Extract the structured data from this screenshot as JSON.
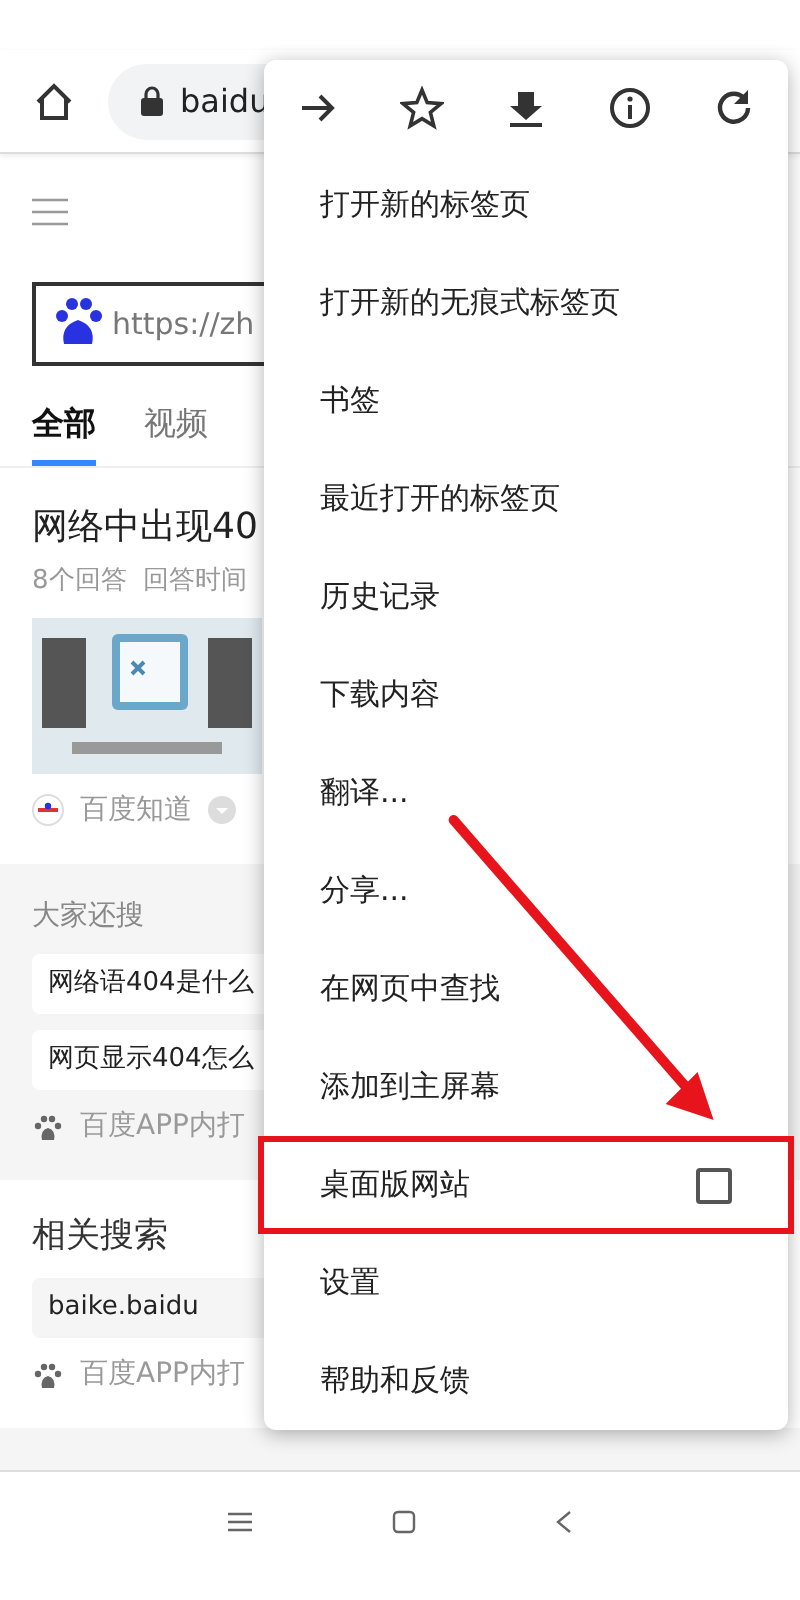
{
  "toolbar": {
    "url": "baidu"
  },
  "page": {
    "search_url": "https://zh",
    "tabs": [
      {
        "label": "全部",
        "selected": true
      },
      {
        "label": "视频",
        "selected": false
      }
    ],
    "result": {
      "title": "网络中出现40",
      "meta": [
        "8个回答",
        "回答时间"
      ],
      "source": "百度知道"
    },
    "also_searched": {
      "heading": "大家还搜",
      "chips": [
        "网络语404是什么",
        "网页显示404怎么"
      ],
      "open_in_app": "百度APP内打"
    },
    "related": {
      "heading": "相关搜索",
      "chips": [
        "baike.baidu"
      ],
      "open_in_app": "百度APP内打"
    }
  },
  "menu": {
    "actions": [
      {
        "kind": "forward"
      },
      {
        "kind": "bookmark"
      },
      {
        "kind": "download"
      },
      {
        "kind": "info"
      },
      {
        "kind": "reload"
      }
    ],
    "items": [
      {
        "label": "打开新的标签页",
        "highlighted": false
      },
      {
        "label": "打开新的无痕式标签页",
        "highlighted": false
      },
      {
        "label": "书签",
        "highlighted": false
      },
      {
        "label": "最近打开的标签页",
        "highlighted": false
      },
      {
        "label": "历史记录",
        "highlighted": false
      },
      {
        "label": "下载内容",
        "highlighted": false
      },
      {
        "label": "翻译...",
        "highlighted": false
      },
      {
        "label": "分享...",
        "highlighted": false
      },
      {
        "label": "在网页中查找",
        "highlighted": false
      },
      {
        "label": "添加到主屏幕",
        "highlighted": false
      },
      {
        "label": "桌面版网站",
        "kind": "checkbox",
        "checked": false,
        "highlighted": true
      },
      {
        "label": "设置",
        "highlighted": false
      },
      {
        "label": "帮助和反馈",
        "highlighted": false
      }
    ]
  }
}
